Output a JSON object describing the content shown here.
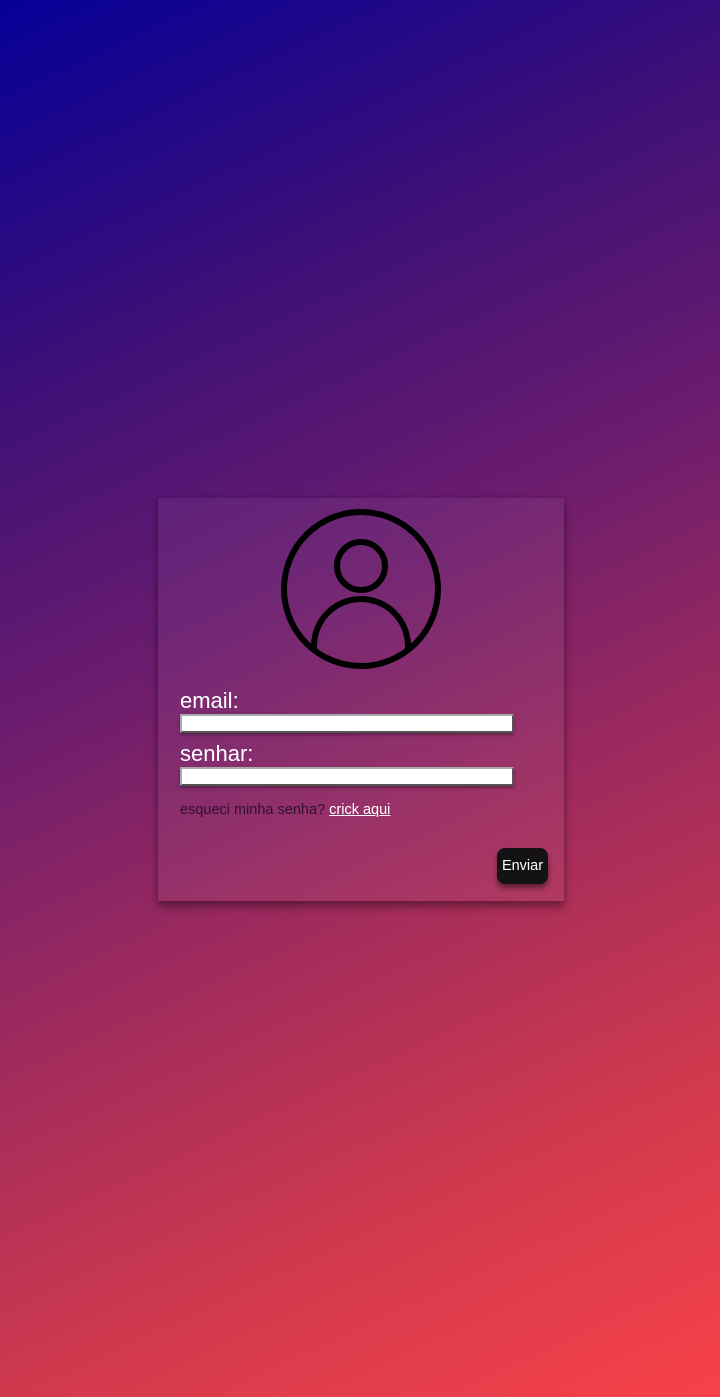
{
  "login": {
    "icon": "user-circle-icon",
    "email_label": "email:",
    "email_value": "",
    "password_label": "senhar:",
    "password_value": "",
    "forgot_text": "esqueci minha senha?",
    "forgot_link": "crick aqui",
    "submit_label": "Enviar"
  },
  "colors": {
    "gradient_start": "#050098",
    "gradient_end": "#f8414a",
    "button_bg": "#141214",
    "text": "#ffffff"
  }
}
